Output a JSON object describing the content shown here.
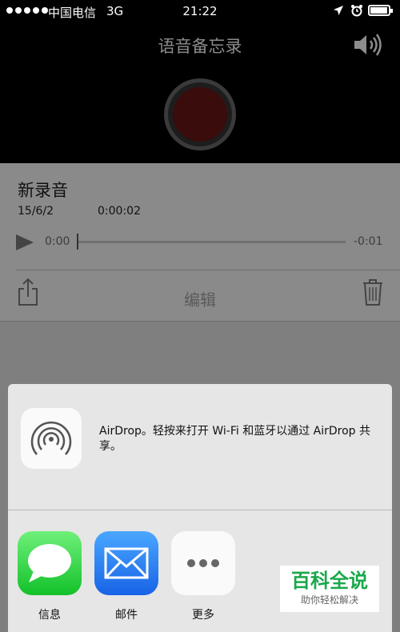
{
  "status_bar": {
    "carrier": "中国电信",
    "network": "3G",
    "time": "21:22",
    "battery_level": 0.95
  },
  "header": {
    "title": "语音备忘录"
  },
  "recording": {
    "title": "新录音",
    "date": "15/6/2",
    "duration": "0:00:02",
    "elapsed": "0:00",
    "remaining": "-0:01",
    "progress": 0.0,
    "edit_label": "编辑"
  },
  "share_sheet": {
    "airdrop_text": "AirDrop。轻按来打开 Wi-Fi 和蓝牙以通过 AirDrop 共享。",
    "apps": [
      {
        "label": "信息",
        "icon": "messages-icon"
      },
      {
        "label": "邮件",
        "icon": "mail-icon"
      },
      {
        "label": "更多",
        "icon": "more-icon"
      }
    ]
  },
  "watermark": {
    "title": "百科全说",
    "subtitle": "助你轻松解决"
  },
  "colors": {
    "status_bg": "#000000",
    "dim_overlay": "#7f7f7f",
    "messages_green": "#12c12a",
    "mail_blue": "#1763e6",
    "watermark_green": "#1aa84a"
  }
}
